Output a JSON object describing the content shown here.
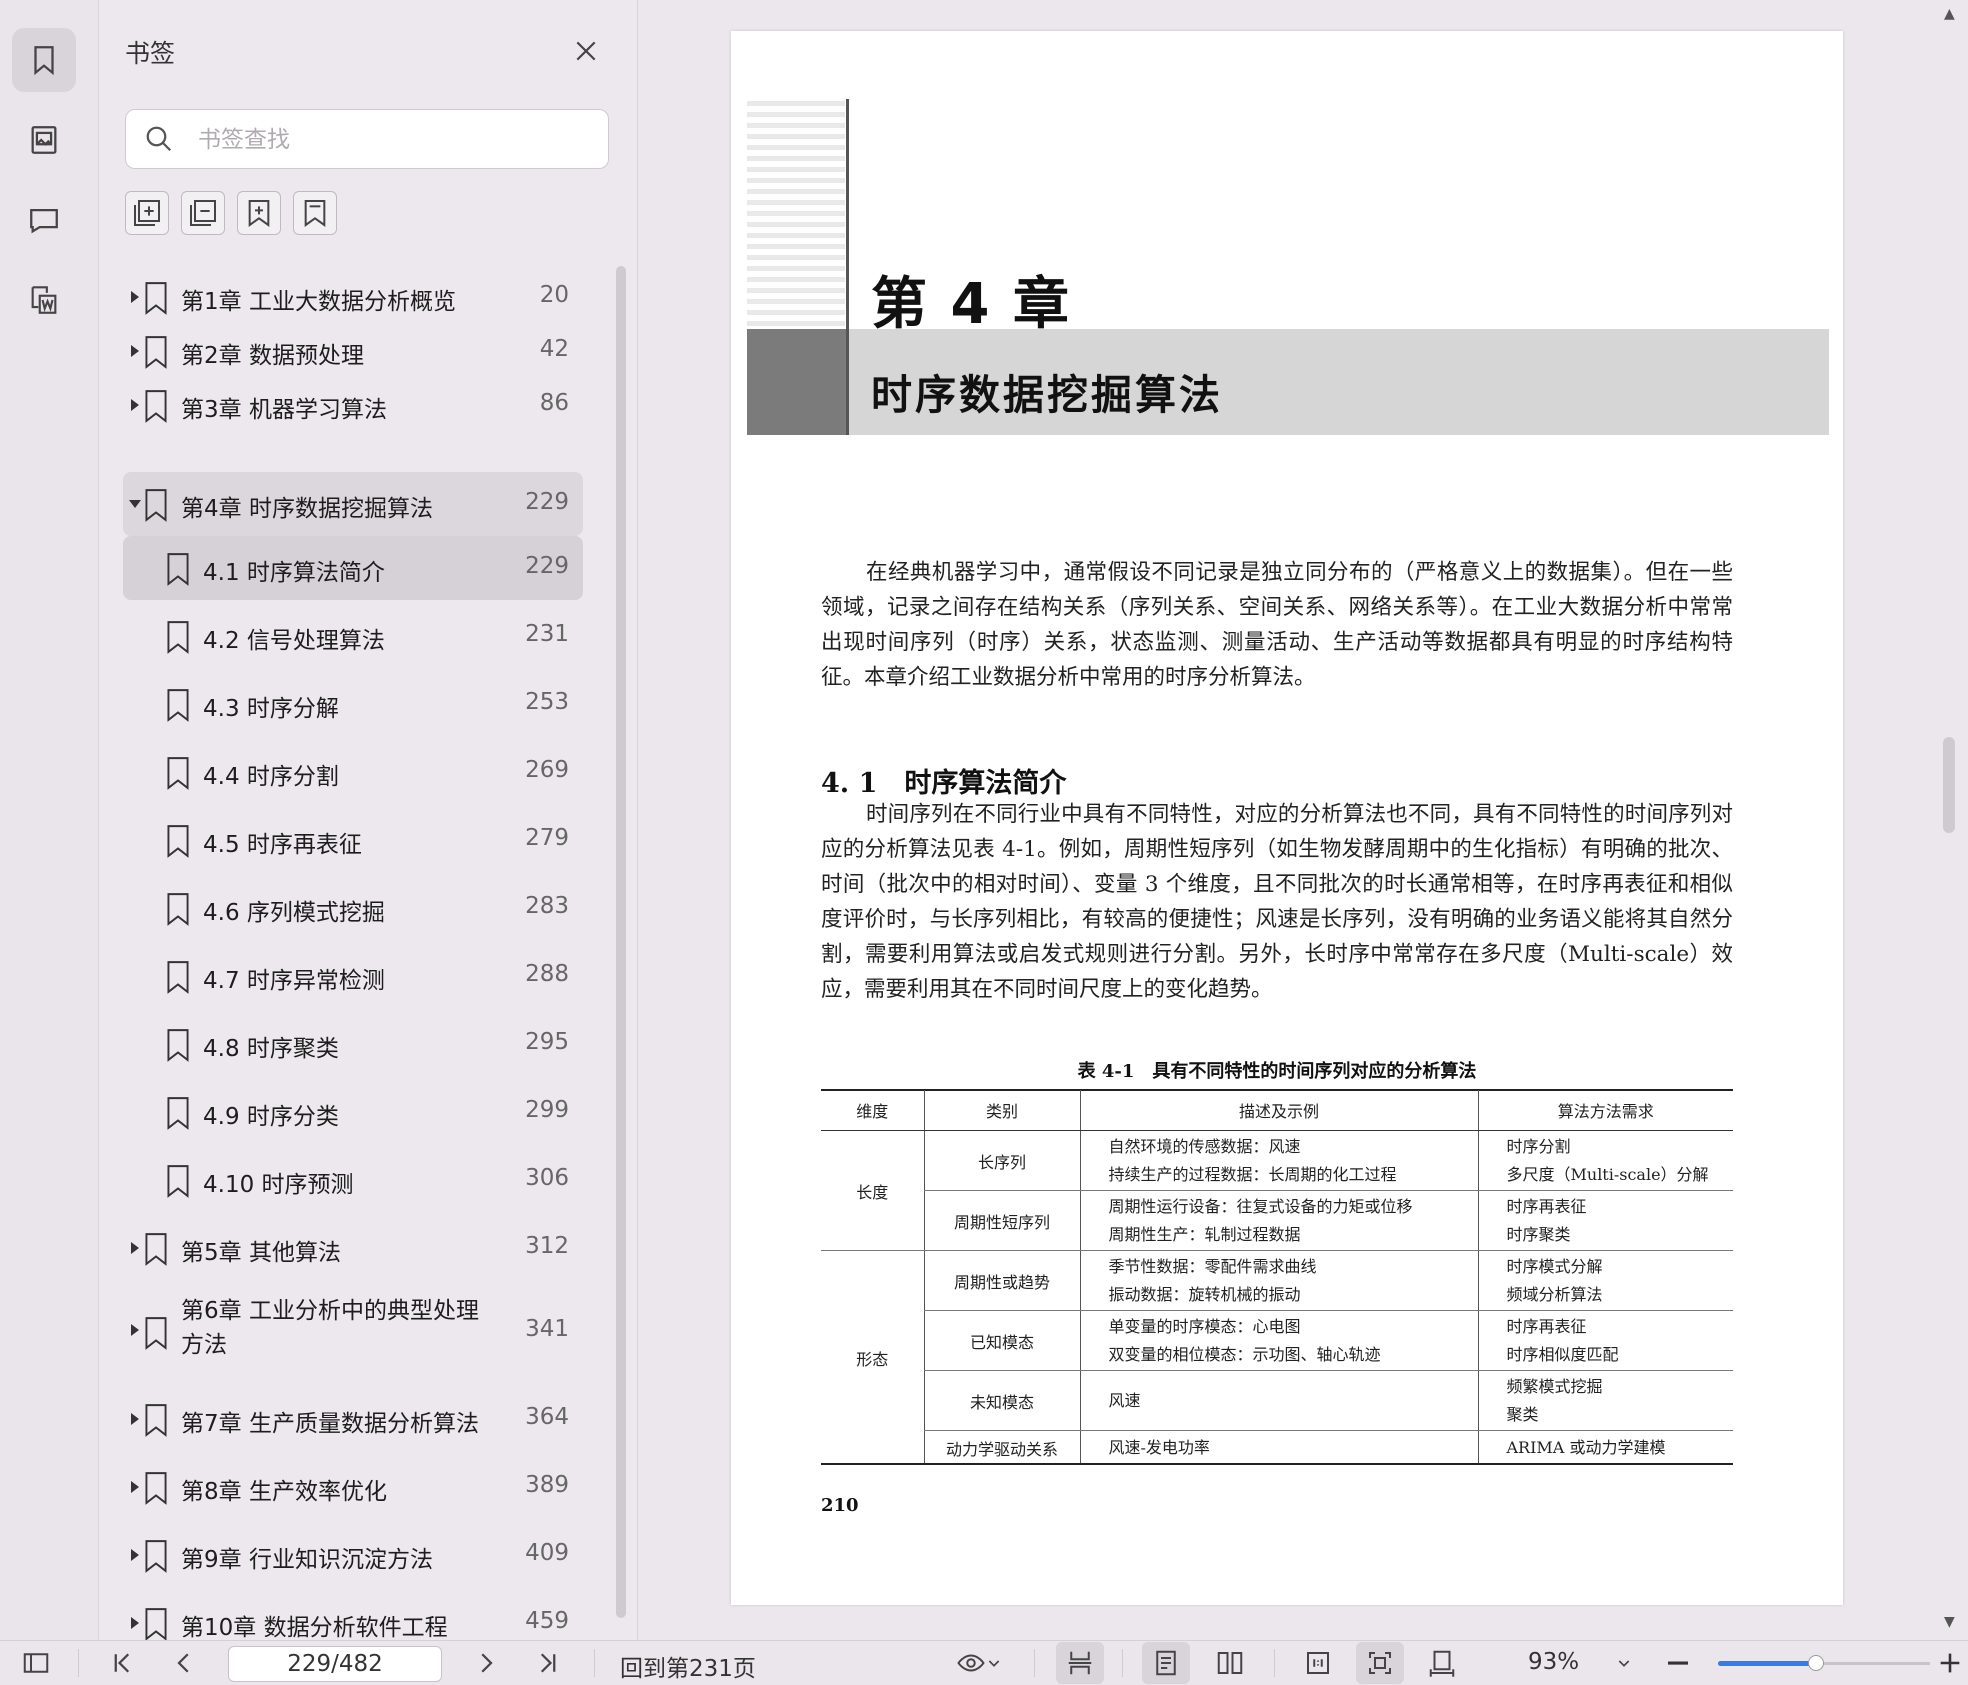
{
  "sidebar": {
    "title": "书签",
    "search_placeholder": "书签查找",
    "rail_icons": [
      "bookmark-icon",
      "image-icon",
      "comment-icon",
      "word-convert-icon"
    ],
    "tools": [
      "expand-all-icon",
      "collapse-all-icon",
      "add-bookmark-icon",
      "bookmark-outline-icon"
    ],
    "bookmarks": [
      {
        "label": "第1章 工业大数据分析概览",
        "page": "20"
      },
      {
        "label": "第2章 数据预处理",
        "page": "42"
      },
      {
        "label": "第3章 机器学习算法",
        "page": "86"
      },
      {
        "label": "第4章 时序数据挖掘算法",
        "page": "229"
      },
      {
        "label": "4.1 时序算法简介",
        "page": "229"
      },
      {
        "label": "4.2 信号处理算法",
        "page": "231"
      },
      {
        "label": "4.3 时序分解",
        "page": "253"
      },
      {
        "label": "4.4 时序分割",
        "page": "269"
      },
      {
        "label": "4.5 时序再表征",
        "page": "279"
      },
      {
        "label": "4.6 序列模式挖掘",
        "page": "283"
      },
      {
        "label": "4.7 时序异常检测",
        "page": "288"
      },
      {
        "label": "4.8 时序聚类",
        "page": "295"
      },
      {
        "label": "4.9 时序分类",
        "page": "299"
      },
      {
        "label": "4.10 时序预测",
        "page": "306"
      },
      {
        "label": "第5章 其他算法",
        "page": "312"
      },
      {
        "label": "第6章 工业分析中的典型处理方法",
        "page": "341"
      },
      {
        "label": "第7章 生产质量数据分析算法",
        "page": "364"
      },
      {
        "label": "第8章 生产效率优化",
        "page": "389"
      },
      {
        "label": "第9章 行业知识沉淀方法",
        "page": "409"
      },
      {
        "label": "第10章 数据分析软件工程",
        "page": "459"
      }
    ]
  },
  "doc": {
    "chapter_number": "第 4 章",
    "chapter_title": "时序数据挖掘算法",
    "intro": "在经典机器学习中，通常假设不同记录是独立同分布的（严格意义上的数据集）。但在一些领域，记录之间存在结构关系（序列关系、空间关系、网络关系等）。在工业大数据分析中常常出现时间序列（时序）关系，状态监测、测量活动、生产活动等数据都具有明显的时序结构特征。本章介绍工业数据分析中常用的时序分析算法。",
    "section_heading": "4. 1　时序算法简介",
    "section_body": "时间序列在不同行业中具有不同特性，对应的分析算法也不同，具有不同特性的时间序列对应的分析算法见表 4-1。例如，周期性短序列（如生物发酵周期中的生化指标）有明确的批次、时间（批次中的相对时间）、变量 3 个维度，且不同批次的时长通常相等，在时序再表征和相似度评价时，与长序列相比，有较高的便捷性；风速是长序列，没有明确的业务语义能将其自然分割，需要利用算法或启发式规则进行分割。另外，长时序中常常存在多尺度（Multi-scale）效应，需要利用其在不同时间尺度上的变化趋势。",
    "table_caption": "表 4-1　具有不同特性的时间序列对应的分析算法",
    "table_headers": [
      "维度",
      "类别",
      "描述及示例",
      "算法方法需求"
    ],
    "table": {
      "dim_length": "长度",
      "dim_shape": "形态",
      "r1_cat": "长序列",
      "r1_desc_1": "自然环境的传感数据：风速",
      "r1_desc_2": "持续生产的过程数据：长周期的化工过程",
      "r1_alg_1": "时序分割",
      "r1_alg_2": "多尺度（Multi-scale）分解",
      "r2_cat": "周期性短序列",
      "r2_desc_1": "周期性运行设备：往复式设备的力矩或位移",
      "r2_desc_2": "周期性生产：轧制过程数据",
      "r2_alg_1": "时序再表征",
      "r2_alg_2": "时序聚类",
      "r3_cat": "周期性或趋势",
      "r3_desc_1": "季节性数据：零配件需求曲线",
      "r3_desc_2": "振动数据：旋转机械的振动",
      "r3_alg_1": "时序模式分解",
      "r3_alg_2": "频域分析算法",
      "r4_cat": "已知模态",
      "r4_desc_1": "单变量的时序模态：心电图",
      "r4_desc_2": "双变量的相位模态：示功图、轴心轨迹",
      "r4_alg_1": "时序再表征",
      "r4_alg_2": "时序相似度匹配",
      "r5_cat": "未知模态",
      "r5_desc_1": "风速",
      "r5_alg_1": "频繁模式挖掘",
      "r5_alg_2": "聚类",
      "r6_cat": "动力学驱动关系",
      "r6_desc_1": "风速-发电功率",
      "r6_alg_1": "ARIMA 或动力学建模"
    },
    "page_number": "210"
  },
  "toolbar": {
    "page_field": "229/482",
    "back_to_page": "回到第231页",
    "zoom": "93%",
    "zoom_level": 0.46
  }
}
